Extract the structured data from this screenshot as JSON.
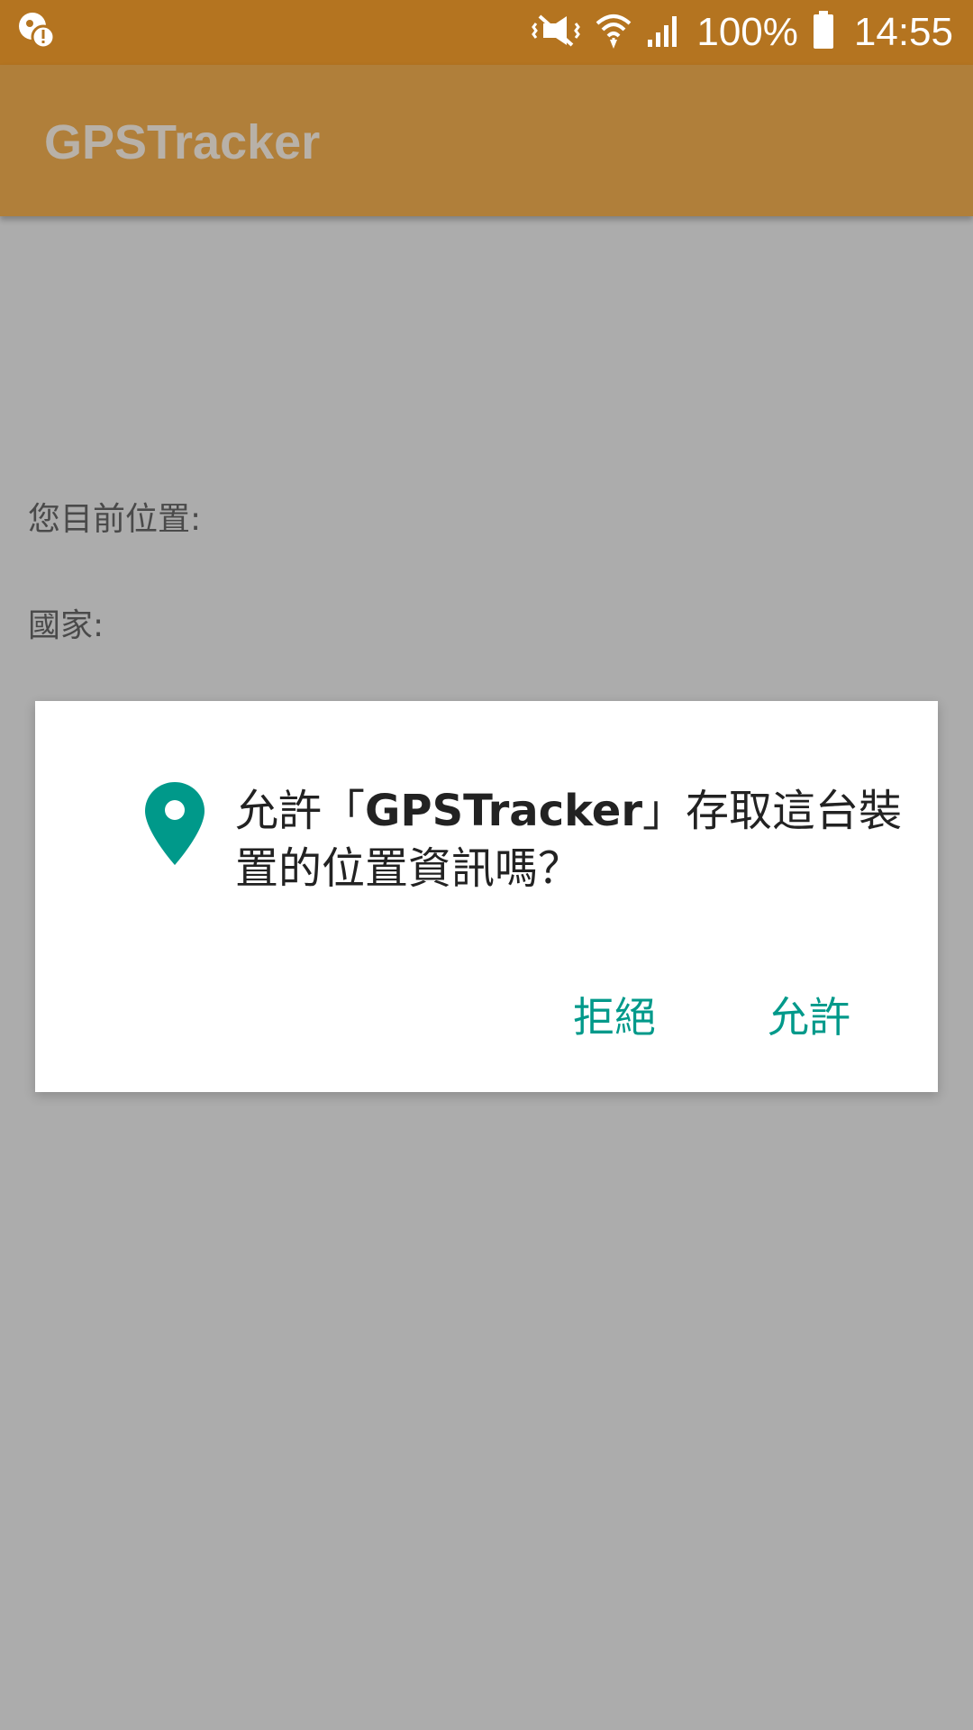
{
  "status_bar": {
    "battery_percent": "100%",
    "time": "14:55",
    "icons": [
      "notification-alert-icon",
      "vibrate-icon",
      "wifi-icon",
      "signal-icon",
      "battery-icon"
    ]
  },
  "app_bar": {
    "title": "GPSTracker"
  },
  "content": {
    "location_label": "您目前位置:",
    "country_label": "國家:",
    "row3_char": "",
    "row4_char": "",
    "row5_char": "",
    "row6_char": ""
  },
  "dialog": {
    "message_prefix": "允許「",
    "app_name": "GPSTracker",
    "message_suffix": "」存取這台裝置的位置資訊嗎？",
    "deny_label": "拒絕",
    "allow_label": "允許",
    "icon": "location-pin-icon",
    "accent_color": "#00998a"
  },
  "colors": {
    "status_bar": "#b47420",
    "app_bar": "#b07f3a",
    "scrim_background": "#acacac"
  }
}
